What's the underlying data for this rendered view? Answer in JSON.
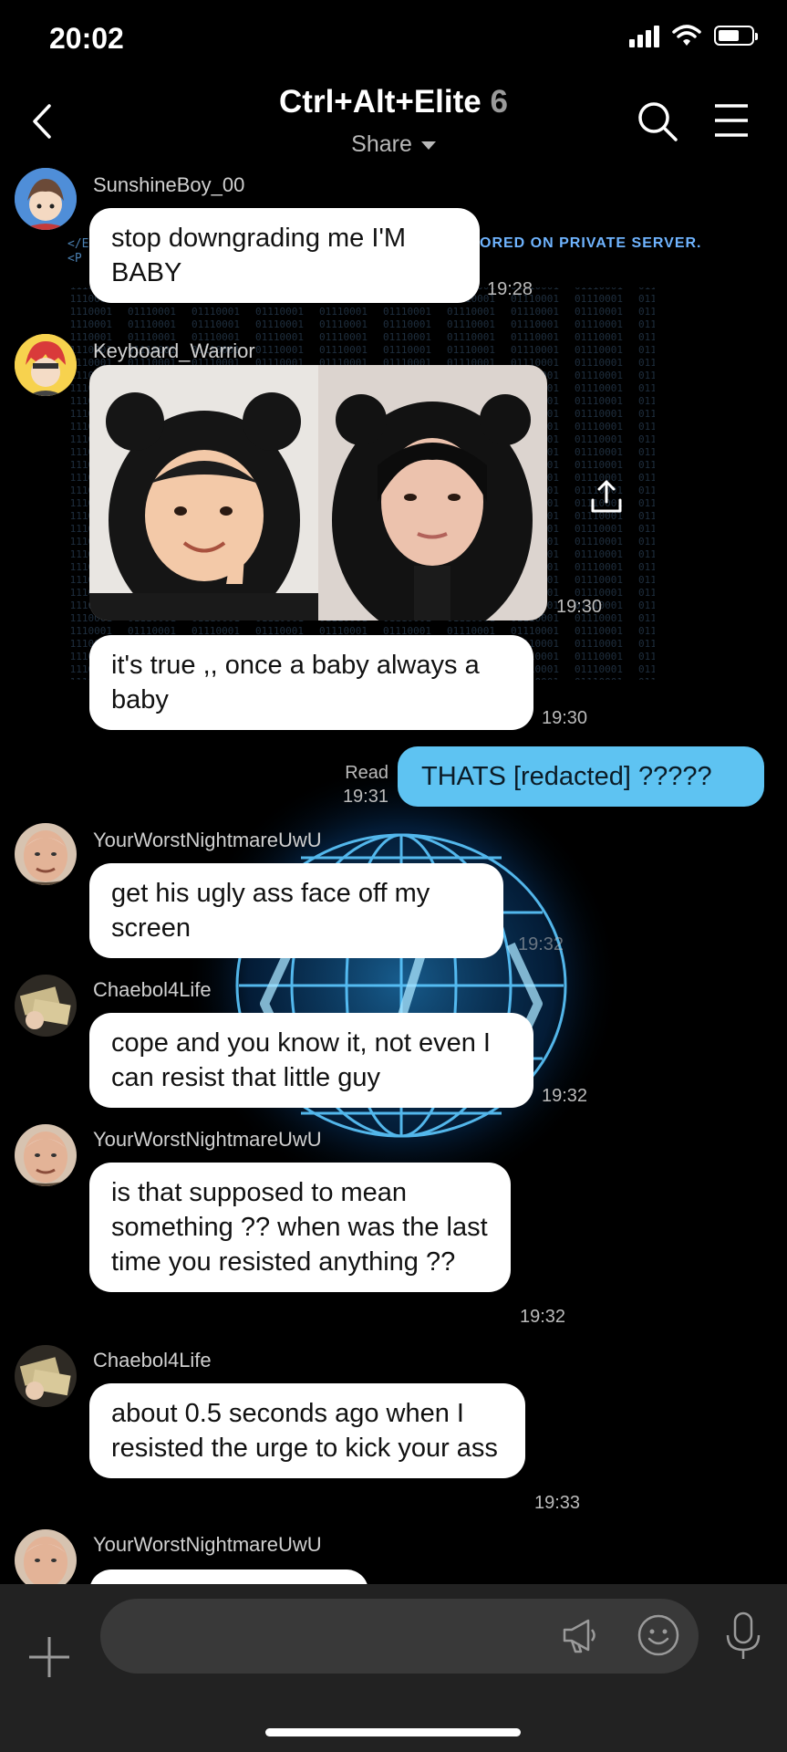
{
  "status": {
    "time": "20:02"
  },
  "header": {
    "title": "Ctrl+Alt+Elite",
    "member_count": "6",
    "share_label": "Share"
  },
  "background": {
    "line1": "</E",
    "line2": "<P",
    "server_text": "ORED ON PRIVATE SERVER."
  },
  "messages": [
    {
      "sender": "SunshineBoy_00",
      "text": "stop downgrading me I'M BABY",
      "time": "19:28",
      "avatar_icon": "anime-boy-avatar"
    },
    {
      "sender": "Keyboard_Warrior",
      "type": "image",
      "time": "19:30",
      "avatar_icon": "red-hair-anime-avatar"
    },
    {
      "text": "it's true ,, once a baby always a baby",
      "time": "19:30"
    },
    {
      "own": true,
      "text": "THATS [redacted] ?????",
      "read_label": "Read",
      "time": "19:31"
    },
    {
      "sender": "YourWorstNightmareUwU",
      "text": "get his ugly ass face off my screen",
      "time": "19:32",
      "avatar_icon": "old-man-avatar"
    },
    {
      "sender": "Chaebol4Life",
      "text": "cope and you know it, not even I can resist that little guy",
      "time": "19:32",
      "avatar_icon": "money-avatar"
    },
    {
      "sender": "YourWorstNightmareUwU",
      "text": "is that supposed to mean something ?? when was the last time you resisted anything ??",
      "time": "19:32",
      "avatar_icon": "old-man-avatar"
    },
    {
      "sender": "Chaebol4Life",
      "text": "about 0.5 seconds ago when I resisted the urge to kick your ass",
      "time": "19:33",
      "avatar_icon": "money-avatar"
    },
    {
      "sender": "YourWorstNightmareUwU",
      "avatar_icon": "old-man-avatar"
    }
  ],
  "composer": {
    "placeholder": ""
  },
  "colors": {
    "own_bubble": "#5ec3f2",
    "background": "#000000",
    "input_bar": "#222222"
  }
}
